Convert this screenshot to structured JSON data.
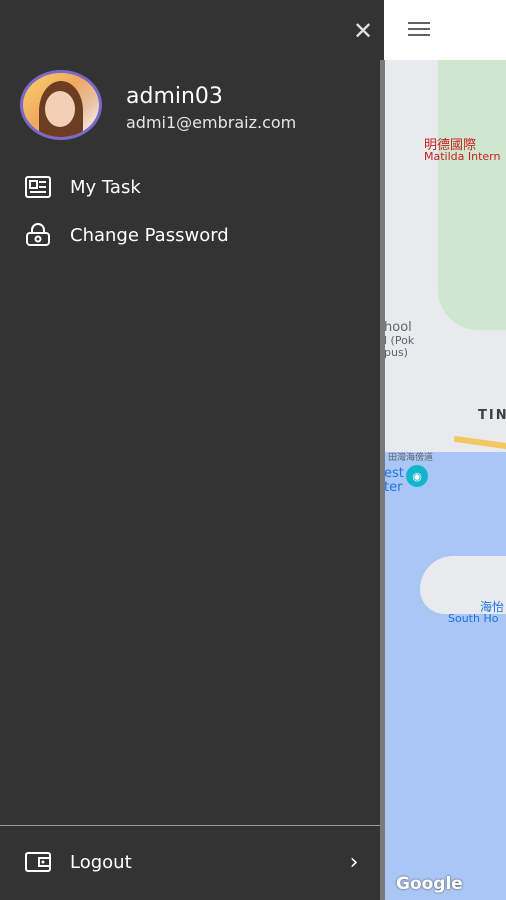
{
  "drawer": {
    "user": {
      "name": "admin03",
      "email": "admi1@embraiz.com"
    },
    "menu": [
      {
        "label": "My Task",
        "icon": "task-list-icon"
      },
      {
        "label": "Change Password",
        "icon": "lock-icon"
      }
    ],
    "logout": {
      "label": "Logout",
      "icon": "wallet-icon"
    }
  },
  "map": {
    "labels": [
      "明德國際",
      "Matilda Intern",
      "hool",
      "l (Pok",
      "pus)",
      "TIN",
      "田灣海傍道",
      "est",
      "ter",
      "海怡",
      "South Ho"
    ],
    "attribution": "Google"
  },
  "colors": {
    "drawer_bg": "#333333",
    "avatar_ring": "#7b68c8",
    "water": "#a9c6f5",
    "park": "#cfe6cf"
  }
}
